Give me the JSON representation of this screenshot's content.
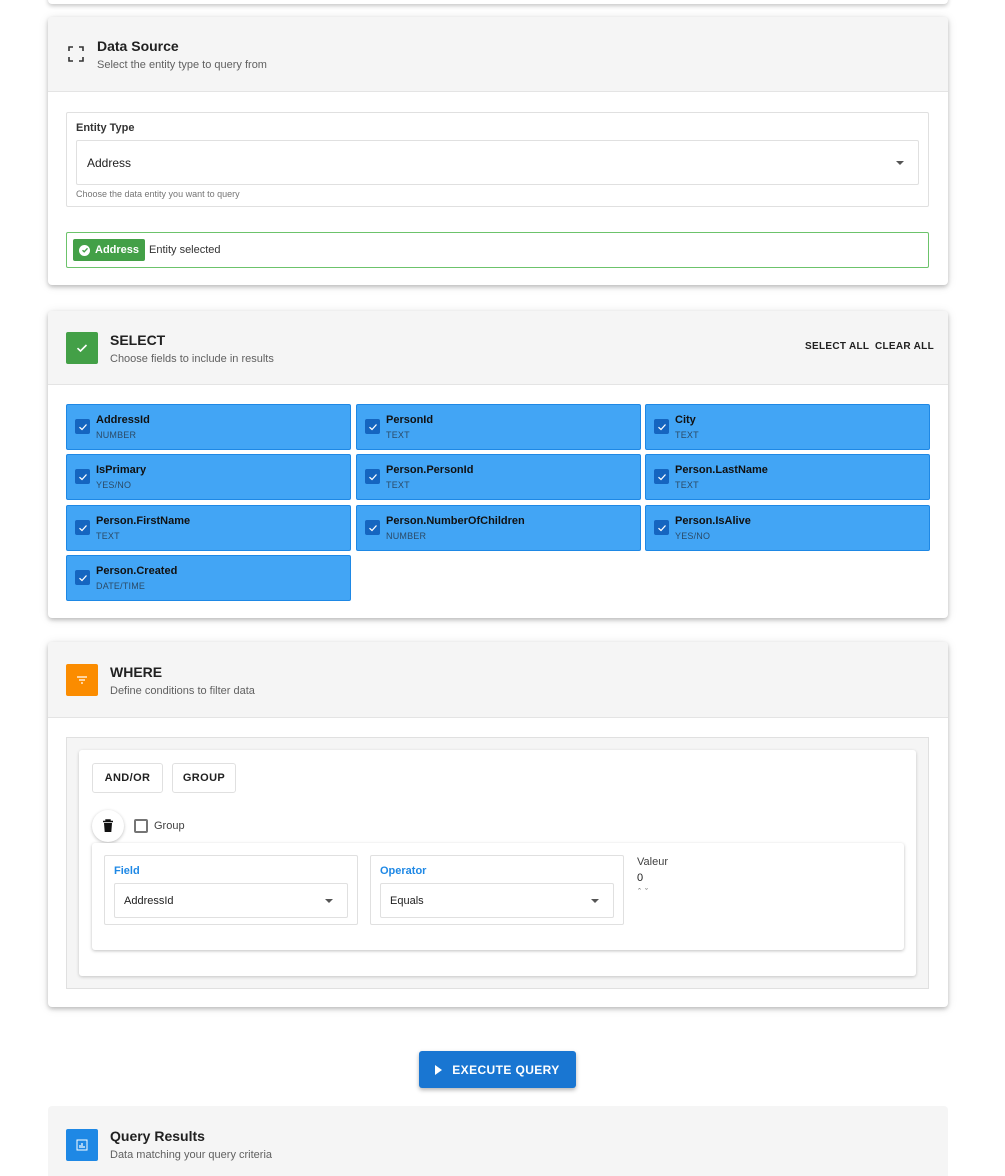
{
  "data_source": {
    "title": "Data Source",
    "subtitle": "Select the entity type to query from",
    "entity_label": "Entity Type",
    "entity_value": "Address",
    "entity_help": "Choose the data entity you want to query",
    "selected_chip": "Address",
    "selected_text": "Entity selected",
    "icon": "fullscreen-icon"
  },
  "select": {
    "title": "SELECT",
    "subtitle": "Choose fields to include in results",
    "select_all": "SELECT ALL",
    "clear_all": "CLEAR ALL",
    "accent": "#43a047",
    "fields": [
      {
        "name": "AddressId",
        "type": "NUMBER",
        "checked": true
      },
      {
        "name": "PersonId",
        "type": "TEXT",
        "checked": true
      },
      {
        "name": "City",
        "type": "TEXT",
        "checked": true
      },
      {
        "name": "IsPrimary",
        "type": "YES/NO",
        "checked": true
      },
      {
        "name": "Person.PersonId",
        "type": "TEXT",
        "checked": true
      },
      {
        "name": "Person.LastName",
        "type": "TEXT",
        "checked": true
      },
      {
        "name": "Person.FirstName",
        "type": "TEXT",
        "checked": true
      },
      {
        "name": "Person.NumberOfChildren",
        "type": "NUMBER",
        "checked": true
      },
      {
        "name": "Person.IsAlive",
        "type": "YES/NO",
        "checked": true
      },
      {
        "name": "Person.Created",
        "type": "DATE/TIME",
        "checked": true
      }
    ]
  },
  "where": {
    "title": "WHERE",
    "subtitle": "Define conditions to filter data",
    "accent": "#fb8c00",
    "and_or": "AND/OR",
    "group_btn": "GROUP",
    "group_label": "Group",
    "rule": {
      "field_label": "Field",
      "field_value": "AddressId",
      "operator_label": "Operator",
      "operator_value": "Equals",
      "value_label": "Valeur",
      "value": "0"
    }
  },
  "execute": {
    "label": "EXECUTE QUERY"
  },
  "results": {
    "title": "Query Results",
    "subtitle": "Data matching your query criteria",
    "accent": "#1e88e5"
  }
}
